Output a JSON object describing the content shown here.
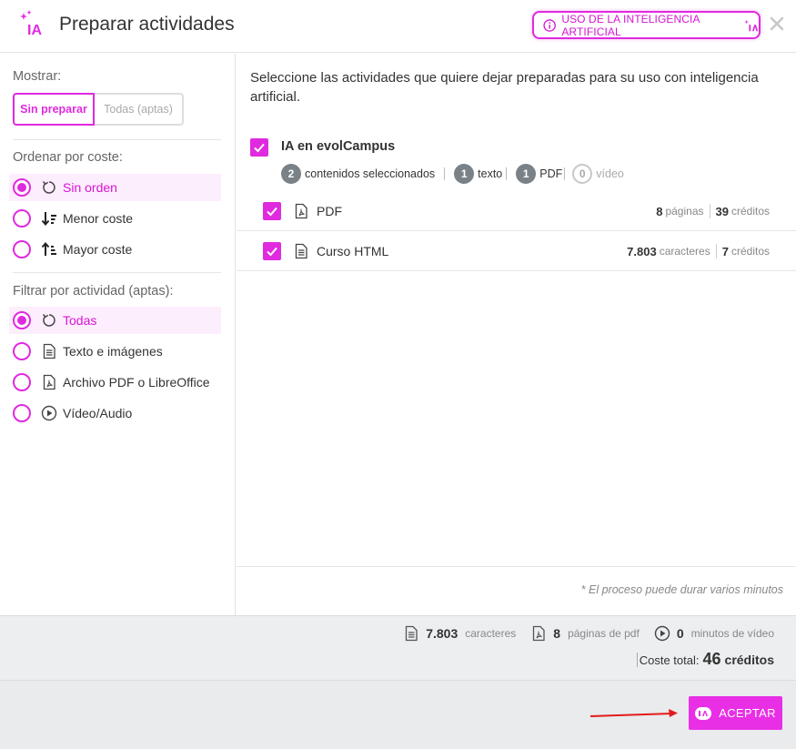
{
  "header": {
    "title": "Preparar actividades",
    "ai_usage_label": "USO DE LA INTELIGENCIA ARTIFICIAL",
    "logo_text": "IA"
  },
  "sidebar": {
    "show_label": "Mostrar:",
    "show_options": [
      "Sin preparar",
      "Todas (aptas)"
    ],
    "show_selected": "Sin preparar",
    "order_label": "Ordenar por coste:",
    "order_options": [
      {
        "label": "Sin orden",
        "icon": "reset-icon",
        "selected": true
      },
      {
        "label": "Menor coste",
        "icon": "sort-ascending-icon",
        "selected": false
      },
      {
        "label": "Mayor coste",
        "icon": "sort-descending-icon",
        "selected": false
      }
    ],
    "filter_label": "Filtrar por actividad (aptas):",
    "filter_options": [
      {
        "label": "Todas",
        "icon": "reset-icon",
        "selected": true
      },
      {
        "label": "Texto e imágenes",
        "icon": "document-icon",
        "selected": false
      },
      {
        "label": "Archivo PDF o LibreOffice",
        "icon": "pdf-file-icon",
        "selected": false
      },
      {
        "label": "Vídeo/Audio",
        "icon": "play-icon",
        "selected": false
      }
    ]
  },
  "main": {
    "intro": "Seleccione las actividades que quiere dejar preparadas para su uso con inteligencia artificial.",
    "group": {
      "title": "IA en evolCampus",
      "checked": true,
      "stats": [
        {
          "count": "2",
          "label": "contenidos seleccionados"
        },
        {
          "count": "1",
          "label": "texto"
        },
        {
          "count": "1",
          "label": "PDF"
        },
        {
          "count": "0",
          "label": "vídeo"
        }
      ]
    },
    "items": [
      {
        "name": "PDF",
        "icon": "pdf-file-icon",
        "checked": true,
        "amount": "8",
        "amount_unit": "páginas",
        "credits": "39",
        "credits_unit": "créditos"
      },
      {
        "name": "Curso HTML",
        "icon": "document-icon",
        "checked": true,
        "amount": "7.803",
        "amount_unit": "caracteres",
        "credits": "7",
        "credits_unit": "créditos"
      }
    ],
    "note": "* El proceso puede durar varios minutos"
  },
  "summary": {
    "characters": "7.803",
    "characters_label": "caracteres",
    "pdf_pages": "8",
    "pdf_pages_label": "páginas de pdf",
    "video_minutes": "0",
    "video_minutes_label": "minutos de vídeo",
    "cost_label": "Coste total:",
    "cost_value": "46",
    "cost_unit": "créditos"
  },
  "footer": {
    "accept_label": "ACEPTAR"
  },
  "colors": {
    "accent": "#e02adf",
    "arrow": "#e31b1b"
  }
}
